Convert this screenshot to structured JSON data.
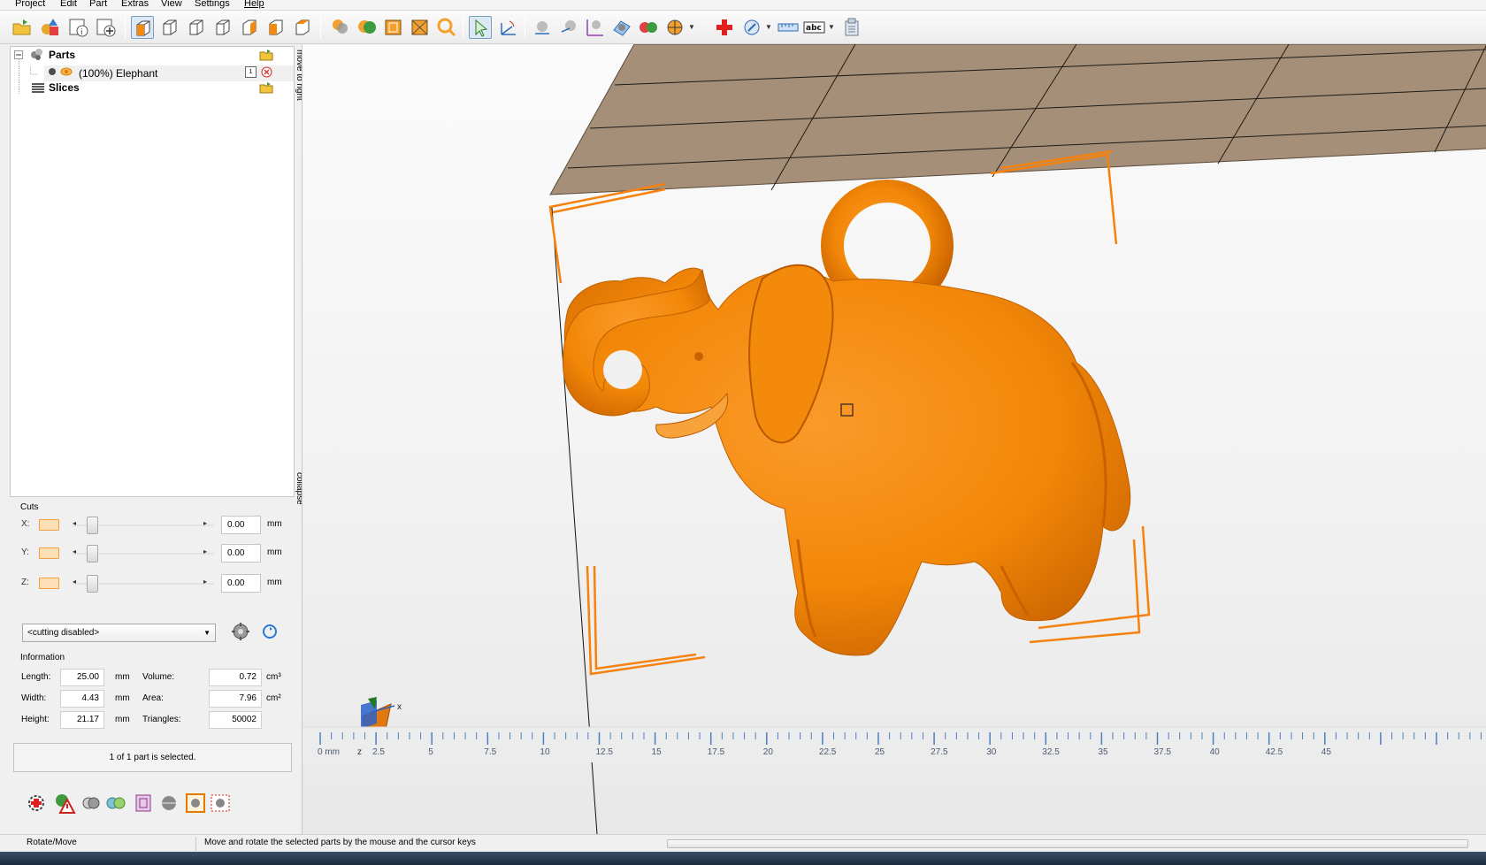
{
  "menu": [
    "Project",
    "Edit",
    "Part",
    "Extras",
    "View",
    "Settings",
    "Help"
  ],
  "toolbar_icons": [
    "open-folder-icon",
    "add-shapes-icon",
    "part-info-icon",
    "add-part-icon",
    "view-perspective-icon",
    "view-front-icon",
    "view-back-icon",
    "view-left-icon",
    "view-right-icon",
    "view-top-icon",
    "view-bottom-icon",
    "shaded-view-icon",
    "shaded-wireframe-icon",
    "wireframe-icon",
    "triangles-view-icon",
    "zoom-icon",
    "select-pointer-icon",
    "rotate-move-icon",
    "sphere-icon",
    "rotate-sphere-icon",
    "measure-axes-icon",
    "plane-icon",
    "boolean-spheres-icon",
    "section-ball-icon",
    "repair-cross-icon",
    "label-icon",
    "ruler-icon",
    "text-abc-icon",
    "report-icon"
  ],
  "tree": {
    "parts_label": "Parts",
    "part_item_label": "(100%) Elephant",
    "part_index": "1",
    "slices_label": "Slices"
  },
  "side_tabs": {
    "move_to_right": "move to right",
    "collapse": "collapse"
  },
  "cuts": {
    "title": "Cuts",
    "rows": [
      {
        "axis": "X:",
        "value": "0.00",
        "unit": "mm"
      },
      {
        "axis": "Y:",
        "value": "0.00",
        "unit": "mm"
      },
      {
        "axis": "Z:",
        "value": "0.00",
        "unit": "mm"
      }
    ],
    "mode": "<cutting disabled>"
  },
  "info": {
    "title": "Information",
    "length_label": "Length:",
    "length": "25.00",
    "length_unit": "mm",
    "width_label": "Width:",
    "width": "4.43",
    "width_unit": "mm",
    "height_label": "Height:",
    "height": "21.17",
    "height_unit": "mm",
    "volume_label": "Volume:",
    "volume": "0.72",
    "volume_unit": "cm³",
    "area_label": "Area:",
    "area": "7.96",
    "area_unit": "cm²",
    "triangles_label": "Triangles:",
    "triangles": "50002"
  },
  "selection_text": "1 of 1 part is selected.",
  "bottom_tools": [
    "repair-gear-icon",
    "warning-icon",
    "merge-shells-icon",
    "split-icon",
    "boundary-icon",
    "sphere-grey-icon",
    "frame-select-icon",
    "flip-triangles-icon"
  ],
  "ruler": {
    "labels": [
      "0 mm",
      "2.5",
      "5",
      "7.5",
      "10",
      "12.5",
      "15",
      "17.5",
      "20",
      "22.5",
      "25",
      "27.5",
      "30",
      "32.5",
      "35",
      "37.5",
      "40",
      "42.5",
      "45"
    ],
    "axis_z": "z",
    "axis_x": "x"
  },
  "status": {
    "mode": "Rotate/Move",
    "message": "Move and rotate the selected parts by the mouse and the cursor keys"
  },
  "colors": {
    "model": "#f48a0c",
    "model_shadow": "#d46a00",
    "platform": "#a58f78",
    "accent": "#f6820d"
  }
}
